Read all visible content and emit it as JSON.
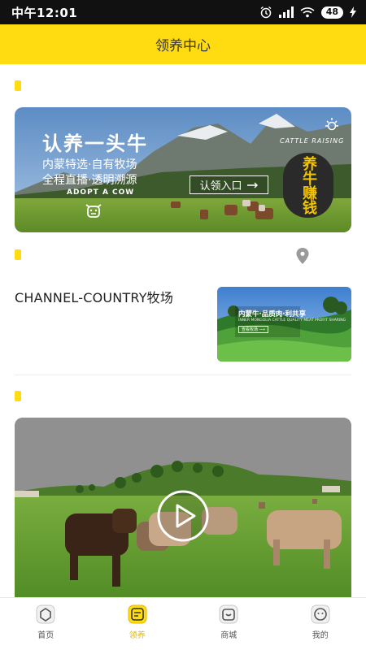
{
  "status_bar": {
    "time": "中午12:01",
    "battery": "48"
  },
  "header": {
    "title": "领养中心"
  },
  "banner": {
    "title": "认养一头牛",
    "subtitle_line1": "内蒙特选·自有牧场",
    "subtitle_line2": "全程直播·透明溯源",
    "english_label": "ADOPT A COW",
    "cta_label": "认领入口",
    "cattle_raising_text": "CATTLE RAISING",
    "badge_text": "养牛赚钱"
  },
  "ranch": {
    "name": "CHANNEL-COUNTRY牧场",
    "thumb_title": "内蒙牛·品质肉·利共享",
    "thumb_subtitle": "INNER MONGOLIA CATTLE QUALITY MEAT PROFIT SHARING",
    "thumb_button": "查看牧场 ⟶"
  },
  "tabs": [
    {
      "label": "首页",
      "icon": "home-icon",
      "active": false
    },
    {
      "label": "领养",
      "icon": "adopt-icon",
      "active": true
    },
    {
      "label": "商城",
      "icon": "shop-icon",
      "active": false
    },
    {
      "label": "我的",
      "icon": "profile-icon",
      "active": false
    }
  ],
  "colors": {
    "accent": "#ffdb12",
    "active_tab": "#e6b800",
    "status_bar": "#111111"
  }
}
